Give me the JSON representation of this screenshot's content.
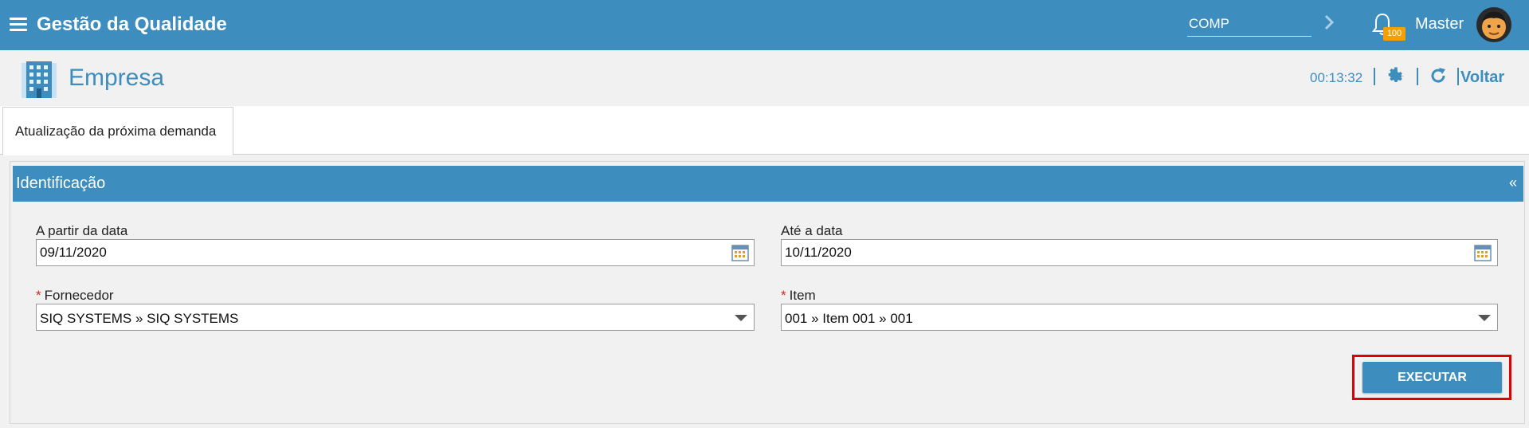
{
  "topbar": {
    "app_title": "Gestão da Qualidade",
    "company_field": "COMP",
    "notification_count": "100",
    "user_name": "Master"
  },
  "page": {
    "title": "Empresa",
    "timer": "00:13:32",
    "back_label": "Voltar"
  },
  "tabs": [
    {
      "label": "Atualização da próxima demanda",
      "active": true
    }
  ],
  "section": {
    "title": "Identificação",
    "collapse_symbol": "«"
  },
  "form": {
    "from_date": {
      "label": "A partir da data",
      "value": "09/11/2020"
    },
    "to_date": {
      "label": "Até a data",
      "value": "10/11/2020"
    },
    "supplier": {
      "label": "Fornecedor",
      "required": true,
      "value": "SIQ SYSTEMS » SIQ SYSTEMS"
    },
    "item": {
      "label": "Item",
      "required": true,
      "value": "001 » Item 001 » 001"
    },
    "required_marker": "*",
    "execute_label": "EXECUTAR"
  },
  "colors": {
    "primary": "#3d8dbf",
    "badge": "#f5a000",
    "highlight": "#e00000",
    "required": "#e02020"
  }
}
